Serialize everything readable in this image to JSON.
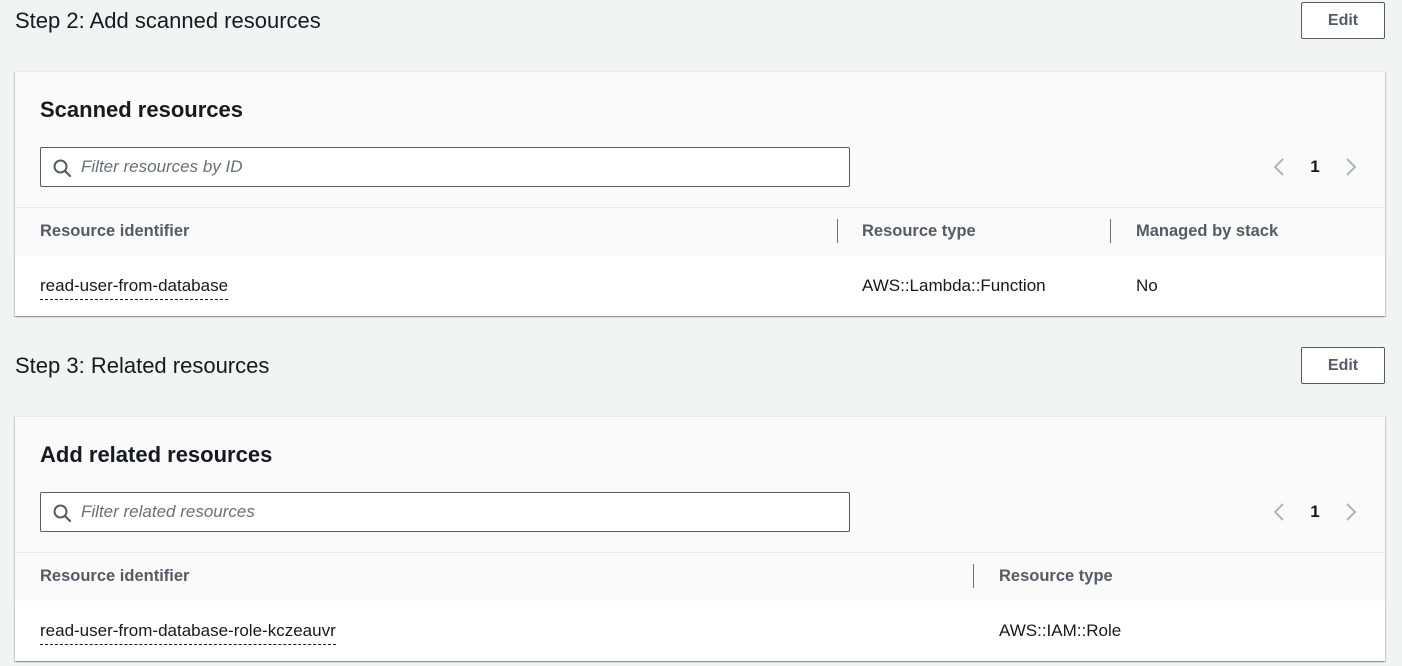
{
  "step2": {
    "title": "Step 2: Add scanned resources",
    "edit_label": "Edit",
    "panel_title": "Scanned resources",
    "filter_placeholder": "Filter resources by ID",
    "page": "1",
    "columns": [
      "Resource identifier",
      "Resource type",
      "Managed by stack"
    ],
    "rows": [
      {
        "identifier": "read-user-from-database",
        "type": "AWS::Lambda::Function",
        "managed": "No"
      }
    ]
  },
  "step3": {
    "title": "Step 3: Related resources",
    "edit_label": "Edit",
    "panel_title": "Add related resources",
    "filter_placeholder": "Filter related resources",
    "page": "1",
    "columns": [
      "Resource identifier",
      "Resource type"
    ],
    "rows": [
      {
        "identifier": "read-user-from-database-role-kczeauvr",
        "type": "AWS::IAM::Role"
      }
    ]
  },
  "icons": {
    "search": "search-icon",
    "prev": "chevron-left-icon",
    "next": "chevron-right-icon"
  },
  "colors": {
    "background": "#f2f3f3",
    "text": "#16191f",
    "muted": "#545b64",
    "disabled": "#aab7b8"
  }
}
